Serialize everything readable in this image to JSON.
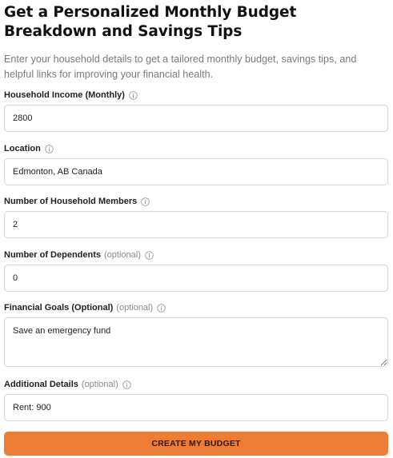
{
  "header": {
    "title": "Get a Personalized Monthly Budget Breakdown and Savings Tips",
    "subtitle": "Enter your household details to get a tailored monthly budget, savings tips, and helpful links for improving your financial health."
  },
  "form": {
    "income": {
      "label": "Household Income (Monthly)",
      "value": "2800",
      "icon": "info-icon"
    },
    "location": {
      "label": "Location",
      "value": "Edmonton, AB Canada",
      "icon": "info-icon"
    },
    "members": {
      "label": "Number of Household Members",
      "value": "2",
      "icon": "info-icon"
    },
    "dependents": {
      "label": "Number of Dependents",
      "optional": "(optional)",
      "value": "0",
      "icon": "info-icon"
    },
    "goals": {
      "label": "Financial Goals (Optional)",
      "optional": "(optional)",
      "value": "Save an emergency fund",
      "icon": "info-icon"
    },
    "details": {
      "label": "Additional Details",
      "optional": "(optional)",
      "value": "Rent: 900",
      "icon": "info-icon"
    },
    "submit_label": "CREATE MY BUDGET"
  },
  "colors": {
    "accent": "#ed7d35",
    "border": "#d6d6d6",
    "muted_text": "#7a7a7a"
  }
}
